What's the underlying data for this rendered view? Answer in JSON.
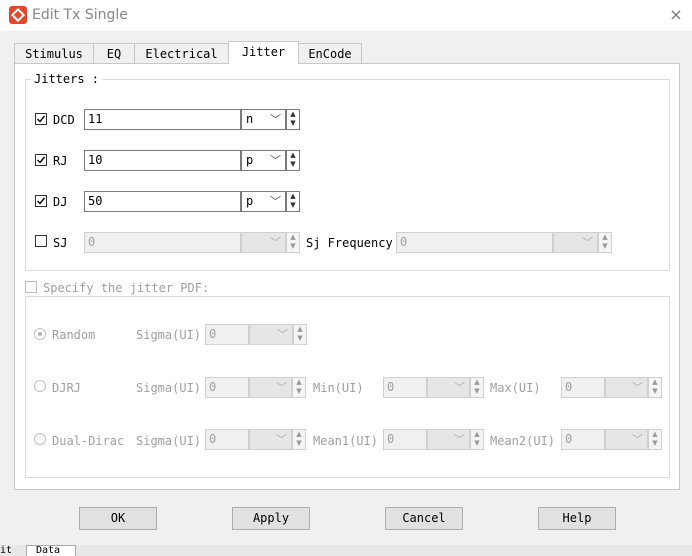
{
  "window": {
    "title": "Edit Tx Single",
    "close_label": "×"
  },
  "tabs": [
    {
      "label": "Stimulus"
    },
    {
      "label": "EQ"
    },
    {
      "label": "Electrical"
    },
    {
      "label": "Jitter"
    },
    {
      "label": "EnCode"
    }
  ],
  "jitters": {
    "legend": "Jitters :",
    "dcd": {
      "label": "DCD",
      "value": "11",
      "unit": "n",
      "checked": true
    },
    "rj": {
      "label": "RJ",
      "value": "10",
      "unit": "p",
      "checked": true
    },
    "dj": {
      "label": "DJ",
      "value": "50",
      "unit": "p",
      "checked": true
    },
    "sj": {
      "label": "SJ",
      "value": "0",
      "unit": "",
      "checked": false
    },
    "sj_frequency": {
      "label": "Sj Frequency",
      "value": "0"
    }
  },
  "pdf": {
    "checkbox_label": "Specify the jitter PDF:",
    "random": {
      "label": "Random",
      "sigma_label": "Sigma(UI)",
      "sigma": "0"
    },
    "djrj": {
      "label": "DJRJ",
      "sigma_label": "Sigma(UI)",
      "sigma": "0",
      "min_label": "Min(UI)",
      "min": "0",
      "max_label": "Max(UI)",
      "max": "0"
    },
    "dual_dirac": {
      "label": "Dual-Dirac",
      "sigma_label": "Sigma(UI)",
      "sigma": "0",
      "mean1_label": "Mean1(UI)",
      "mean1": "0",
      "mean2_label": "Mean2(UI)",
      "mean2": "0"
    }
  },
  "buttons": {
    "ok": "OK",
    "apply": "Apply",
    "cancel": "Cancel",
    "help": "Help"
  },
  "background_tab_fragment": {
    "left": "it",
    "tab": "Data"
  }
}
